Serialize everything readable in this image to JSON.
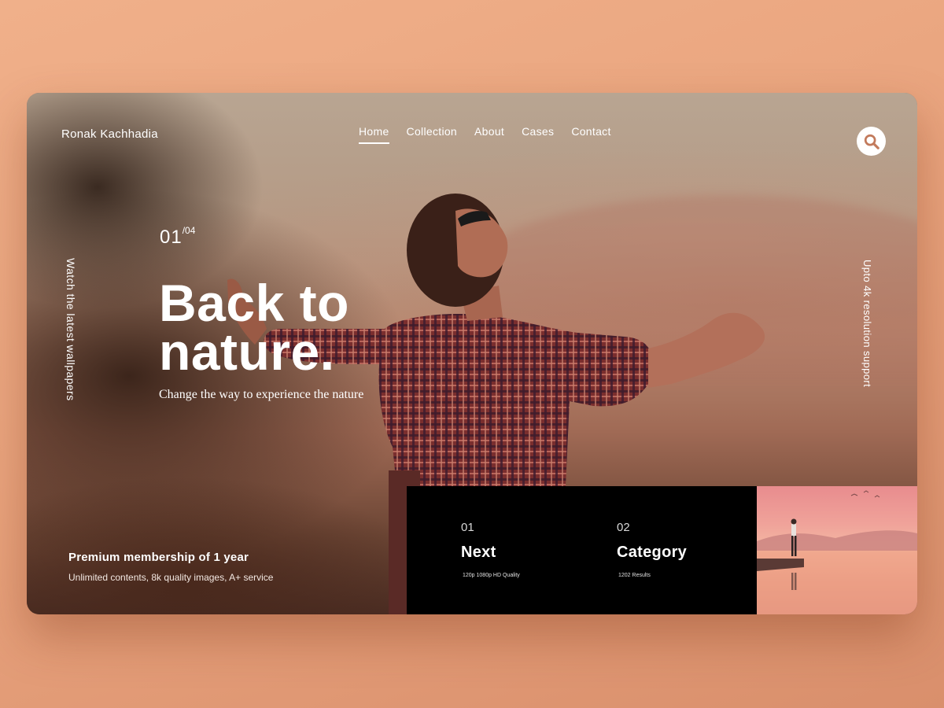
{
  "brand": {
    "name": "Ronak Kachhadia"
  },
  "nav": {
    "items": [
      {
        "label": "Home",
        "active": true
      },
      {
        "label": "Collection",
        "active": false
      },
      {
        "label": "About",
        "active": false
      },
      {
        "label": "Cases",
        "active": false
      },
      {
        "label": "Contact",
        "active": false
      }
    ],
    "search_icon": "search-icon"
  },
  "side": {
    "left_text": "Watch the latest wallpapers",
    "right_text": "Upto 4k resolution support"
  },
  "hero": {
    "slide_current": "01",
    "slide_total": "/04",
    "title_line1": "Back to",
    "title_line2": "nature.",
    "subtitle": "Change the way to experience the nature"
  },
  "membership": {
    "title": "Premium membership of 1 year",
    "description": "Unlimited contents, 8k quality images, A+ service"
  },
  "panel": {
    "items": [
      {
        "number": "01",
        "label": "Next",
        "sub": "120p 1080p HD Quality"
      },
      {
        "number": "02",
        "label": "Category",
        "sub": "1202 Results"
      }
    ]
  },
  "colors": {
    "page_background": "#eba27c",
    "panel_background": "#000000",
    "text": "#ffffff"
  }
}
